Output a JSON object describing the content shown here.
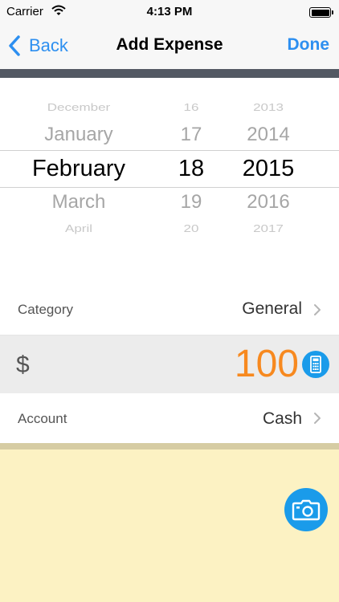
{
  "status_bar": {
    "carrier": "Carrier",
    "time": "4:13 PM"
  },
  "nav": {
    "back_label": "Back",
    "title": "Add Expense",
    "done_label": "Done"
  },
  "date_picker": {
    "months": [
      "December",
      "January",
      "February",
      "March",
      "April"
    ],
    "days": [
      "16",
      "17",
      "18",
      "19",
      "20"
    ],
    "years": [
      "2013",
      "2014",
      "2015",
      "2016",
      "2017"
    ],
    "selected": {
      "month": "February",
      "day": "18",
      "year": "2015"
    }
  },
  "category": {
    "label": "Category",
    "value": "General"
  },
  "amount": {
    "currency": "$",
    "value": "100"
  },
  "account": {
    "label": "Account",
    "value": "Cash"
  },
  "icons": {
    "wifi": "wifi-icon",
    "battery": "battery-icon",
    "back": "chevron-left-icon",
    "disclosure": "chevron-right-icon",
    "calculator": "calculator-icon",
    "camera": "camera-icon"
  },
  "colors": {
    "accent": "#2d8ff0",
    "amount": "#f7891f",
    "icon_button": "#1a9bea",
    "note_background": "#fcf2c3",
    "nav_divider": "#535963"
  }
}
